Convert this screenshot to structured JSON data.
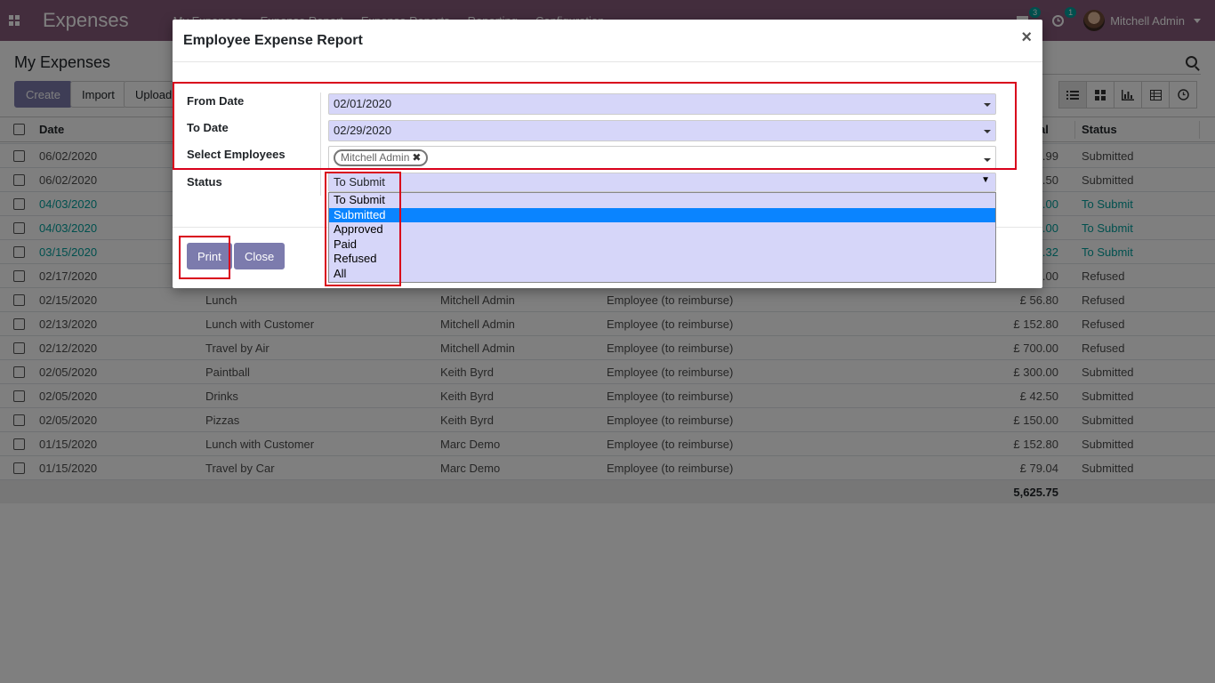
{
  "navbar": {
    "brand": "Expenses",
    "menu": [
      "My Expenses",
      "Expense Report",
      "Expense Reports",
      "Reporting",
      "Configuration"
    ],
    "messages_count": "3",
    "activities_count": "1",
    "user": "Mitchell Admin"
  },
  "control": {
    "breadcrumb": "My Expenses",
    "create_label": "Create",
    "import_label": "Import",
    "upload_label": "Upload"
  },
  "list": {
    "headers": {
      "date": "Date",
      "total": "al",
      "status": "Status"
    },
    "rows": [
      {
        "date": "06/02/2020",
        "desc": "",
        "employee": "",
        "paid_by": "",
        "total": ".99",
        "status": "Submitted",
        "teal": false
      },
      {
        "date": "06/02/2020",
        "desc": "",
        "employee": "",
        "paid_by": "",
        "total": ".50",
        "status": "Submitted",
        "teal": false
      },
      {
        "date": "04/03/2020",
        "desc": "",
        "employee": "",
        "paid_by": "",
        "total": ".00",
        "status": "To Submit",
        "teal": true
      },
      {
        "date": "04/03/2020",
        "desc": "",
        "employee": "",
        "paid_by": "",
        "total": ".00",
        "status": "To Submit",
        "teal": true
      },
      {
        "date": "03/15/2020",
        "desc": "",
        "employee": "",
        "paid_by": "",
        "total": ".32",
        "status": "To Submit",
        "teal": true
      },
      {
        "date": "02/17/2020",
        "desc": "",
        "employee": "",
        "paid_by": "",
        "total": ".00",
        "status": "Refused",
        "teal": false
      },
      {
        "date": "02/15/2020",
        "desc": "Lunch",
        "employee": "Mitchell Admin",
        "paid_by": "Employee (to reimburse)",
        "total": "£ 56.80",
        "status": "Refused",
        "teal": false
      },
      {
        "date": "02/13/2020",
        "desc": "Lunch with Customer",
        "employee": "Mitchell Admin",
        "paid_by": "Employee (to reimburse)",
        "total": "£ 152.80",
        "status": "Refused",
        "teal": false
      },
      {
        "date": "02/12/2020",
        "desc": "Travel by Air",
        "employee": "Mitchell Admin",
        "paid_by": "Employee (to reimburse)",
        "total": "£ 700.00",
        "status": "Refused",
        "teal": false
      },
      {
        "date": "02/05/2020",
        "desc": "Paintball",
        "employee": "Keith Byrd",
        "paid_by": "Employee (to reimburse)",
        "total": "£ 300.00",
        "status": "Submitted",
        "teal": false
      },
      {
        "date": "02/05/2020",
        "desc": "Drinks",
        "employee": "Keith Byrd",
        "paid_by": "Employee (to reimburse)",
        "total": "£ 42.50",
        "status": "Submitted",
        "teal": false
      },
      {
        "date": "02/05/2020",
        "desc": "Pizzas",
        "employee": "Keith Byrd",
        "paid_by": "Employee (to reimburse)",
        "total": "£ 150.00",
        "status": "Submitted",
        "teal": false
      },
      {
        "date": "01/15/2020",
        "desc": "Lunch with Customer",
        "employee": "Marc Demo",
        "paid_by": "Employee (to reimburse)",
        "total": "£ 152.80",
        "status": "Submitted",
        "teal": false
      },
      {
        "date": "01/15/2020",
        "desc": "Travel by Car",
        "employee": "Marc Demo",
        "paid_by": "Employee (to reimburse)",
        "total": "£ 79.04",
        "status": "Submitted",
        "teal": false
      }
    ],
    "footer_total": "5,625.75"
  },
  "modal": {
    "title": "Employee Expense Report",
    "close_symbol": "×",
    "from_label": "From Date",
    "from_value": "02/01/2020",
    "to_label": "To Date",
    "to_value": "02/29/2020",
    "employees_label": "Select Employees",
    "employee_tag": "Mitchell Admin",
    "tag_remove": "✖",
    "status_label": "Status",
    "status_value": "To Submit",
    "status_options": [
      "To Submit",
      "Submitted",
      "Approved",
      "Paid",
      "Refused",
      "All"
    ],
    "status_highlighted_option": "Submitted",
    "print_label": "Print",
    "close_label": "Close"
  },
  "colors": {
    "navbar": "#875a7b",
    "primary_button": "#7c7bad",
    "field_bg": "#d6d6f9",
    "teal": "#00a09d",
    "highlight": "#d9001b",
    "option_selected": "#0a84ff"
  }
}
